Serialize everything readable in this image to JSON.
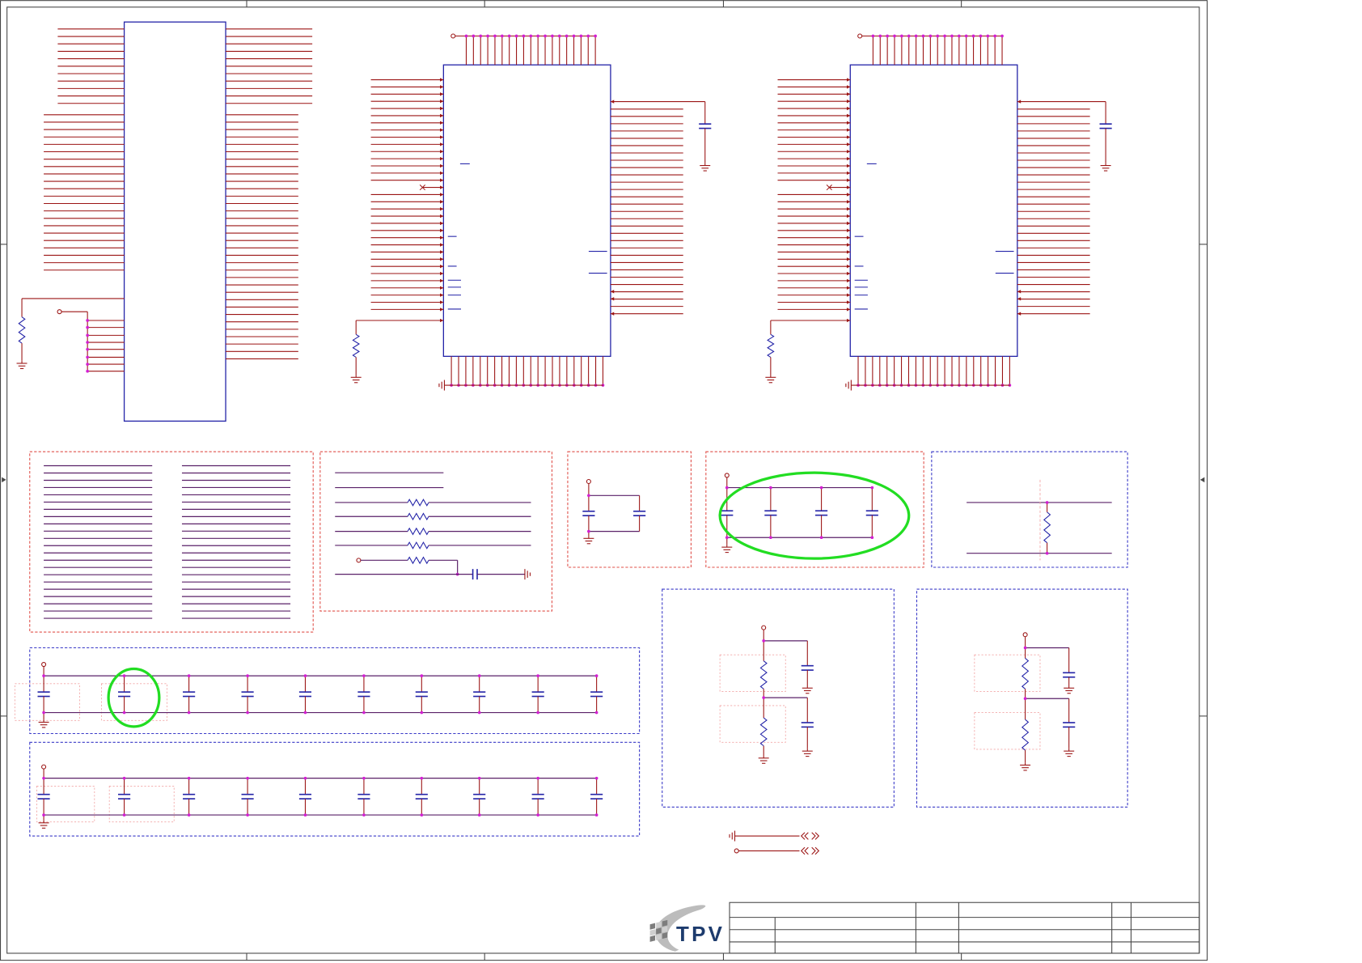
{
  "logo": {
    "text": "TPV"
  },
  "colors": {
    "wire": "#9b1414",
    "component_body": "#2424a8",
    "junction": "#d21fd2",
    "net_line": "#5a2168",
    "highlight": "#22dd22",
    "group_border_red": "#e0504a",
    "group_border_blue": "#3a3ac8",
    "placement_outline": "#f2a6a6",
    "frame": "#474747"
  }
}
